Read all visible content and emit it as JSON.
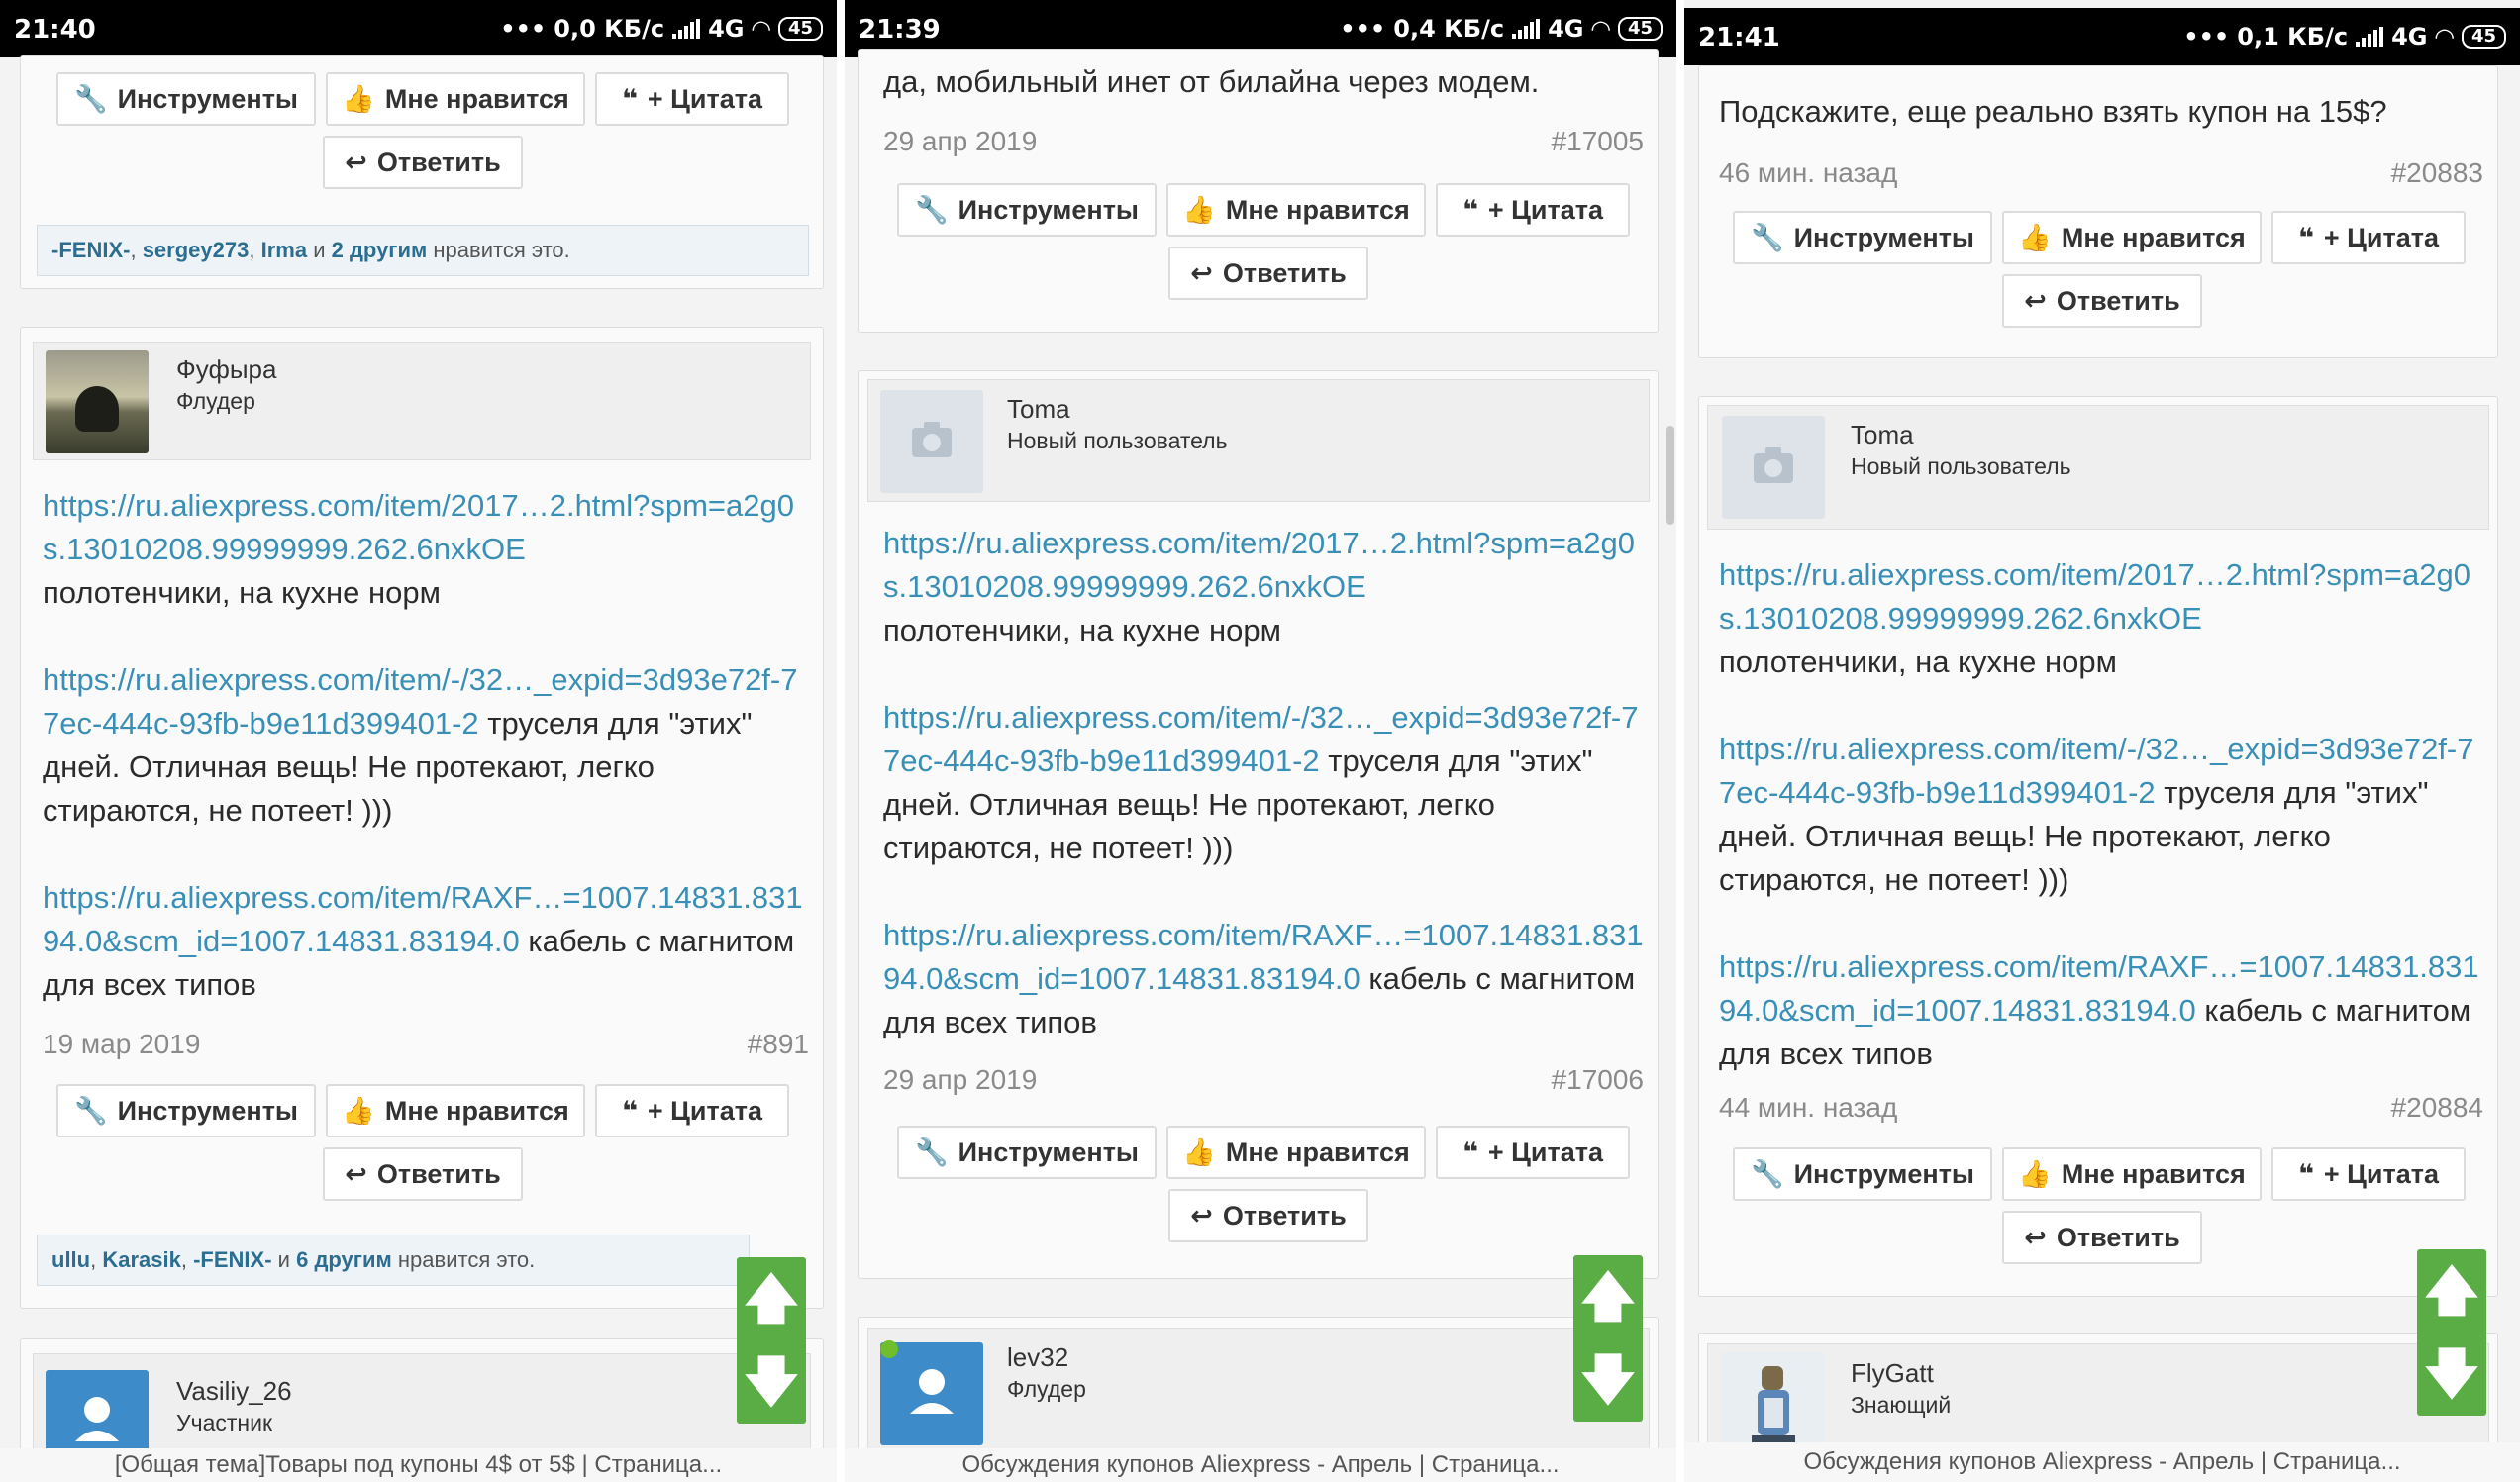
{
  "labels": {
    "tools": "Инструменты",
    "like": "Мне нравится",
    "quote": "+ Цитата",
    "reply": "Ответить",
    "likes_suffix": "нравится это."
  },
  "colors": {
    "link": "#3a8fb7",
    "arrow_bg": "#5aac45",
    "online_dot": "#6fbe2c"
  },
  "icons": [
    "wrench-icon",
    "thumbs-up-icon",
    "quote-icon",
    "reply-icon",
    "camera-icon",
    "arrow-up-icon",
    "arrow-down-icon"
  ],
  "panels": [
    {
      "status": {
        "time": "21:40",
        "speed": "0,0 КБ/с",
        "net": "4G",
        "battery": "45"
      },
      "top_likes": {
        "names": [
          "-FENIX-",
          "sergey273",
          "Irma"
        ],
        "and": "и",
        "others": "2 другим"
      },
      "post": {
        "author": "Фуфыра",
        "title": "Флудер",
        "link1": "https://ru.aliexpress.com/item/2017…2.html?spm=a2g0s.13010208.99999999.262.6nxkOE",
        "text1": "полотенчики, на кухне норм",
        "link2": "https://ru.aliexpress.com/item/-/32…_expid=3d93e72f-77ec-444c-93fb-b9e11d399401-2",
        "text2": "труселя для \"этих\" дней. Отличная вещь! Не протекают, легко стираются, не потеет! )))",
        "link3": "https://ru.aliexpress.com/item/RAXF…=1007.14831.83194.0&scm_id=1007.14831.83194.0",
        "text3": "кабель с магнитом для всех типов",
        "date": "19 мар 2019",
        "num": "#891"
      },
      "likes": {
        "names": [
          "ullu",
          "Karasik",
          "-FENIX-"
        ],
        "and": "и",
        "others": "6 другим"
      },
      "next": {
        "author": "Vasiliy_26",
        "title": "Участник"
      },
      "footer": "[Общая тема]Товары под купоны 4$ от 5$ | Страница..."
    },
    {
      "status": {
        "time": "21:39",
        "speed": "0,4 КБ/с",
        "net": "4G",
        "battery": "45"
      },
      "prev_text": "да, мобильный инет от билайна через модем.",
      "prev_date": "29 апр 2019",
      "prev_num": "#17005",
      "post": {
        "author": "Toma",
        "title": "Новый пользователь",
        "link1": "https://ru.aliexpress.com/item/2017…2.html?spm=a2g0s.13010208.99999999.262.6nxkOE",
        "text1": "полотенчики, на кухне норм",
        "link2": "https://ru.aliexpress.com/item/-/32…_expid=3d93e72f-77ec-444c-93fb-b9e11d399401-2",
        "text2": "труселя для \"этих\" дней. Отличная вещь! Не протекают, легко стираются, не потеет! )))",
        "link3": "https://ru.aliexpress.com/item/RAXF…=1007.14831.83194.0&scm_id=1007.14831.83194.0",
        "text3": "кабель с магнитом для всех типов",
        "date": "29 апр 2019",
        "num": "#17006"
      },
      "next": {
        "author": "lev32",
        "title": "Флудер"
      },
      "footer": "Обсуждения купонов Aliexpress - Апрель | Страница..."
    },
    {
      "status": {
        "time": "21:41",
        "speed": "0,1 КБ/с",
        "net": "4G",
        "battery": "45"
      },
      "prev_text": "Подскажите, еще реально взять купон на 15$?",
      "prev_date": "46 мин. назад",
      "prev_num": "#20883",
      "post": {
        "author": "Toma",
        "title": "Новый пользователь",
        "link1": "https://ru.aliexpress.com/item/2017…2.html?spm=a2g0s.13010208.99999999.262.6nxkOE",
        "text1": "полотенчики, на кухне норм",
        "link2": "https://ru.aliexpress.com/item/-/32…_expid=3d93e72f-77ec-444c-93fb-b9e11d399401-2",
        "text2": "труселя для \"этих\" дней. Отличная вещь! Не протекают, легко стираются, не потеет! )))",
        "link3": "https://ru.aliexpress.com/item/RAXF…=1007.14831.83194.0&scm_id=1007.14831.83194.0",
        "text3": "кабель с магнитом для всех типов",
        "date": "44 мин. назад",
        "num": "#20884"
      },
      "next": {
        "author": "FlyGatt",
        "title": "Знающий"
      },
      "footer": "Обсуждения купонов Aliexpress - Апрель | Страница..."
    }
  ]
}
